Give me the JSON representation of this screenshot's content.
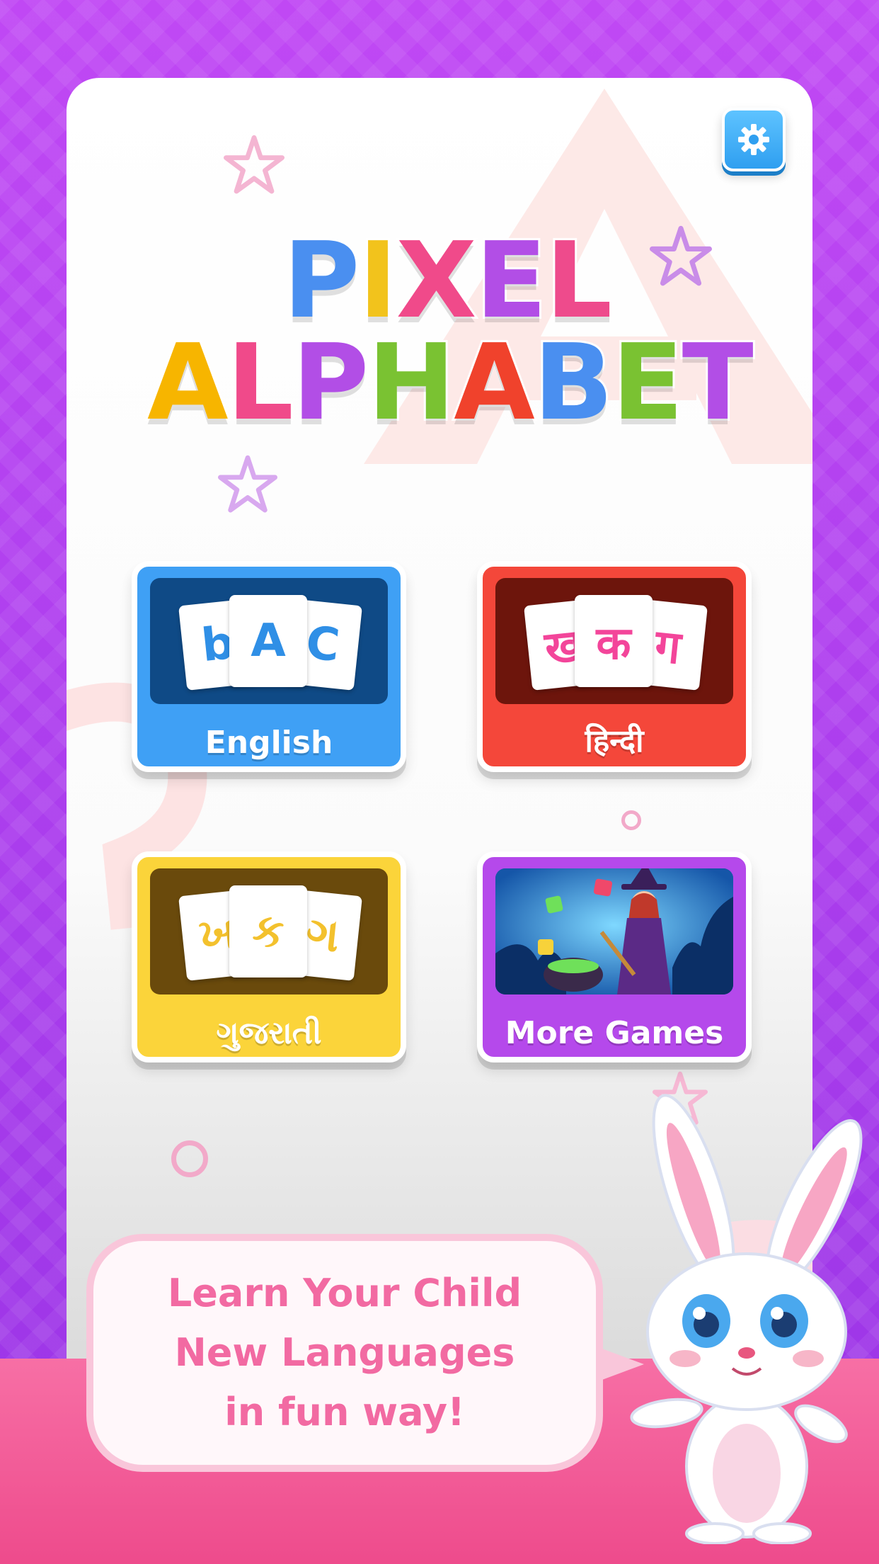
{
  "title": {
    "line1": [
      "P",
      "I",
      "X",
      "E",
      "L"
    ],
    "line1_colors": [
      "#4a8ff0",
      "#f2c31c",
      "#f04a8a",
      "#b24ee6",
      "#ee4b8c"
    ],
    "line2": [
      "A",
      "L",
      "P",
      "H",
      "A",
      "B",
      "E",
      "T"
    ],
    "line2_colors": [
      "#f7b500",
      "#f04a8a",
      "#b24ee6",
      "#7ac232",
      "#f0422c",
      "#4a8ff0",
      "#7ac232",
      "#b24ee6"
    ]
  },
  "settings": {
    "icon": "gear-icon"
  },
  "languages": [
    {
      "label": "English",
      "color": "#3fa0f5",
      "inner": "#0f4a86",
      "cards": [
        "b",
        "A",
        "C"
      ],
      "card_color": "#2f8fe6"
    },
    {
      "label": "हिन्दी",
      "color": "#f4473a",
      "inner": "#6d150c",
      "cards": [
        "ख",
        "क",
        "ग"
      ],
      "card_color": "#f3459a"
    },
    {
      "label": "ગુજરાતી",
      "color": "#fbd43a",
      "inner": "#6a4a0c",
      "cards": [
        "ખ",
        "ક",
        "ગ"
      ],
      "card_color": "#f3c12d"
    }
  ],
  "more_games": {
    "label": "More Games",
    "color": "#b549eb",
    "inner": "#155aa0"
  },
  "speech": {
    "line1": "Learn Your Child",
    "line2": "New Languages",
    "line3": "in fun way!"
  }
}
